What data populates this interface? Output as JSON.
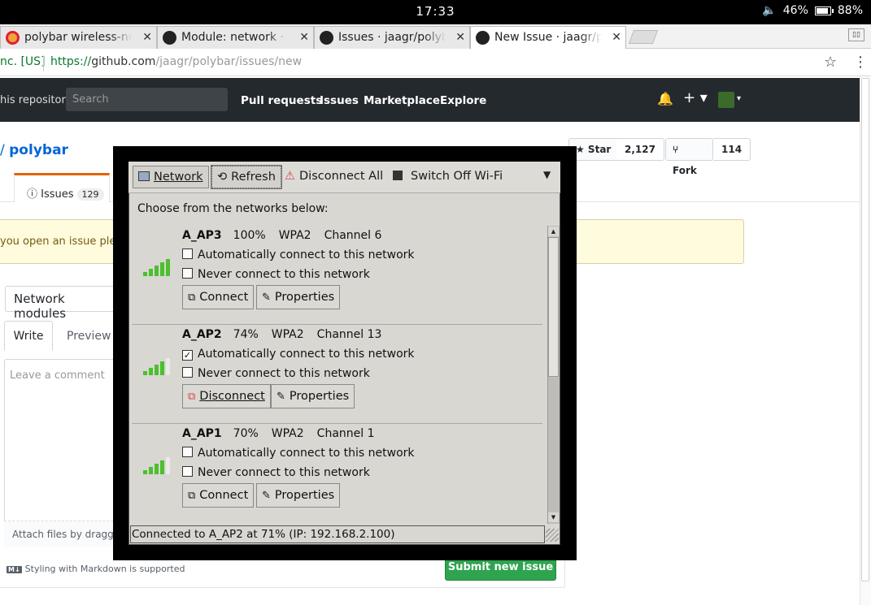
{
  "status_bar": {
    "time": "17:33",
    "volume": "🔈",
    "volume_pct": "46%",
    "battery_pct": "88%",
    "battery_level": 0.88
  },
  "browser": {
    "tabs": [
      {
        "label": "polybar wireless-net",
        "icon": "chrome-icon",
        "active": false
      },
      {
        "label": "Module: network · ja",
        "icon": "github-icon",
        "active": false
      },
      {
        "label": "Issues · jaagr/polyba",
        "icon": "github-icon",
        "active": false
      },
      {
        "label": "New Issue · jaagr/pc",
        "icon": "github-icon",
        "active": true
      }
    ],
    "tab_close": "✕",
    "cert_label": "nc. [US]",
    "url_scheme": "https://",
    "url_host": "github.com",
    "url_path": "/jaagr/polybar/issues/new",
    "star": "☆",
    "menu": "⋮",
    "window_btn": "▯▯"
  },
  "github": {
    "scope": "his repository",
    "search_placeholder": "Search",
    "nav": [
      "Pull requests",
      "Issues",
      "Marketplace",
      "Explore"
    ],
    "bell": "🔔",
    "plus": "+ ▾",
    "avatar_caret": "▾",
    "repo_slash": "/ ",
    "repo_name": "polybar",
    "star_label": "★ Star",
    "star_count": "2,127",
    "fork_label": "Fork",
    "fork_count": "114",
    "issues_tab": "Issues",
    "issues_count": "129",
    "flash": "you open an issue pleas",
    "title_value": "Network modules",
    "write_tab": "Write",
    "preview_tab": "Preview",
    "comment_placeholder": "Leave a comment",
    "attach_text": "Attach files by dragging",
    "markdown_badge": "M↓",
    "markdown_note": "Styling with Markdown is supported",
    "submit_label": "Submit new issue"
  },
  "network_manager": {
    "toolbar": {
      "network_label": "Network",
      "refresh_label": "Refresh",
      "disconnect_all_label": "Disconnect All",
      "wifi_off_label": "Switch Off Wi-Fi",
      "caret": "▼"
    },
    "prompt": "Choose from the networks below:",
    "auto_label": "Automatically connect to this network",
    "never_label": "Never connect to this network",
    "properties_label": "Properties",
    "networks": [
      {
        "ssid": "A_AP3",
        "signal": "100%",
        "security": "WPA2",
        "channel": "Channel 6",
        "bars": 5,
        "auto": false,
        "never": false,
        "action": "Connect"
      },
      {
        "ssid": "A_AP2",
        "signal": "74%",
        "security": "WPA2",
        "channel": "Channel 13",
        "bars": 4,
        "auto": true,
        "never": false,
        "action": "Disconnect"
      },
      {
        "ssid": "A_AP1",
        "signal": "70%",
        "security": "WPA2",
        "channel": "Channel 1",
        "bars": 4,
        "auto": false,
        "never": false,
        "action": "Connect"
      }
    ],
    "status": "Connected to A_AP2 at 71% (IP: 192.168.2.100)",
    "colors": {
      "signal_on": "#4cbf2e",
      "disconnect_icon": "#d9414b"
    }
  }
}
